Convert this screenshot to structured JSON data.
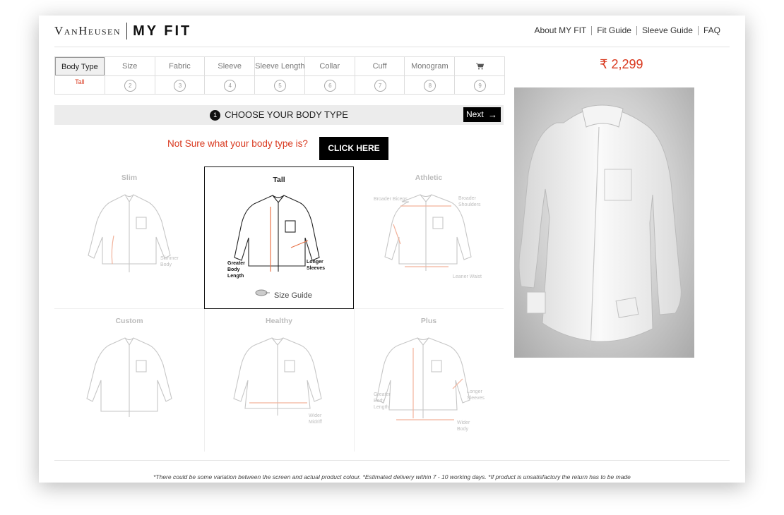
{
  "brand": {
    "name": "VanHeusen",
    "product": "MY FIT"
  },
  "top_nav": [
    "About MY FIT",
    "Fit Guide",
    "Sleeve Guide",
    "FAQ"
  ],
  "steps": [
    {
      "label": "Body Type",
      "value": "Tall",
      "active": true
    },
    {
      "label": "Size",
      "number": "2"
    },
    {
      "label": "Fabric",
      "number": "3"
    },
    {
      "label": "Sleeve",
      "number": "4"
    },
    {
      "label": "Sleeve Length",
      "number": "5"
    },
    {
      "label": "Collar",
      "number": "6"
    },
    {
      "label": "Cuff",
      "number": "7"
    },
    {
      "label": "Monogram",
      "number": "8"
    },
    {
      "label": "",
      "icon": "cart-icon",
      "number": "9"
    }
  ],
  "choose": {
    "number": "1",
    "title": "CHOOSE YOUR BODY TYPE",
    "next_label": "Next"
  },
  "prompt": {
    "text": "Not Sure what your body type is?",
    "button": "CLICK HERE"
  },
  "body_types": [
    {
      "name": "Slim",
      "annotations": [
        "Slimmer",
        "Body"
      ]
    },
    {
      "name": "Tall",
      "annotations": [
        "Greater",
        "Body",
        "Length",
        "Longer",
        "Sleeves"
      ],
      "selected": true,
      "size_guide": "Size Guide"
    },
    {
      "name": "Athletic",
      "annotations": [
        "Broader Biceps",
        "Broader",
        "Shoulders",
        "Leaner Waist"
      ]
    },
    {
      "name": "Custom",
      "annotations": []
    },
    {
      "name": "Healthy",
      "annotations": [
        "Wider",
        "Midriff"
      ]
    },
    {
      "name": "Plus",
      "annotations": [
        "Greater",
        "Body",
        "Length",
        "Longer",
        "Sleeves",
        "Wider",
        "Body"
      ]
    }
  ],
  "price": "₹ 2,299",
  "footnote": "*There could be some variation between the screen and actual product colour.  *Estimated delivery within 7 - 10 working days.  *If product is unsatisfactory the return has to be made",
  "colors": {
    "accent": "#d9381e",
    "dark": "#000000",
    "bar": "#ececec"
  }
}
